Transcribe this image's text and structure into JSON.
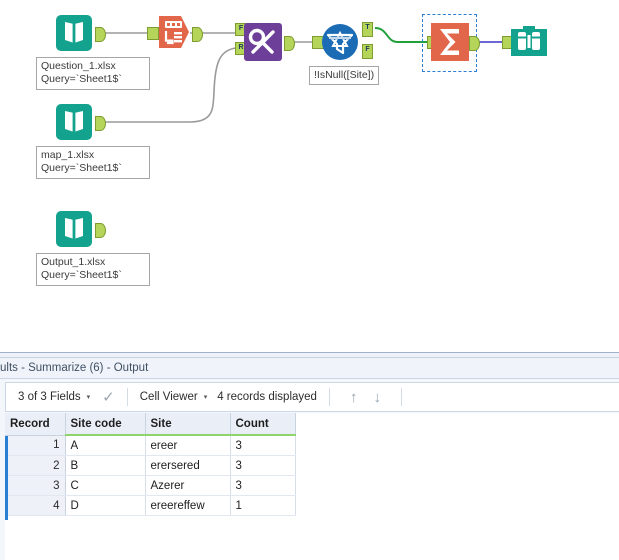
{
  "canvas": {
    "tools": [
      {
        "id": "input1",
        "name": "input-data-tool",
        "type": "input-book-icon",
        "label": "Question_1.xlsx\nQuery=`Sheet1$`"
      },
      {
        "id": "select1",
        "name": "select-tool",
        "type": "select-icon",
        "label": ""
      },
      {
        "id": "findreplace1",
        "name": "find-replace-tool",
        "type": "find-replace-icon",
        "label": "",
        "in_anchors": [
          "F",
          "R"
        ]
      },
      {
        "id": "filter1",
        "name": "filter-tool",
        "type": "filter-icon",
        "label": "!IsNull([Site])",
        "out_anchors": [
          "T",
          "F"
        ]
      },
      {
        "id": "summarize1",
        "name": "summarize-tool",
        "type": "summarize-icon",
        "label": "",
        "selected": true
      },
      {
        "id": "browse1",
        "name": "browse-tool",
        "type": "browse-binoculars-icon",
        "label": ""
      },
      {
        "id": "input2",
        "name": "input-data-tool-map",
        "type": "input-book-icon",
        "label": "map_1.xlsx\nQuery=`Sheet1$`"
      },
      {
        "id": "input3",
        "name": "input-data-tool-output",
        "type": "input-book-icon",
        "label": "Output_1.xlsx\nQuery=`Sheet1$`"
      }
    ],
    "colors": {
      "input_teal": "#13a28e",
      "select_orange": "#e2674a",
      "findreplace_purple": "#6e3f99",
      "filter_blue": "#1c6bb5",
      "summarize_orange": "#e2674a",
      "browse_teal": "#13a28e",
      "anchor_green": "#b5d55a",
      "wire_gray": "#9a9a9a",
      "wire_green": "#22a03c",
      "wire_blue": "#3a36c8",
      "selection_blue": "#2a7fd4"
    }
  },
  "results": {
    "title": "ults - Summarize (6) - Output",
    "toolbar": {
      "fields_label": "3 of 3 Fields",
      "caret": "▾",
      "check_icon": "✓",
      "viewer_label": "Cell Viewer",
      "records_label": "4 records displayed",
      "up_arrow": "↑",
      "down_arrow": "↓"
    },
    "table": {
      "columns": [
        "Record",
        "Site code",
        "Site",
        "Count"
      ],
      "rows": [
        {
          "record": "1",
          "site_code": "A",
          "site": "ereer",
          "count": "3"
        },
        {
          "record": "2",
          "site_code": "B",
          "site": "erersered",
          "count": "3"
        },
        {
          "record": "3",
          "site_code": "C",
          "site": "Azerer",
          "count": "3"
        },
        {
          "record": "4",
          "site_code": "D",
          "site": "ereereffew",
          "count": "1"
        }
      ]
    }
  }
}
